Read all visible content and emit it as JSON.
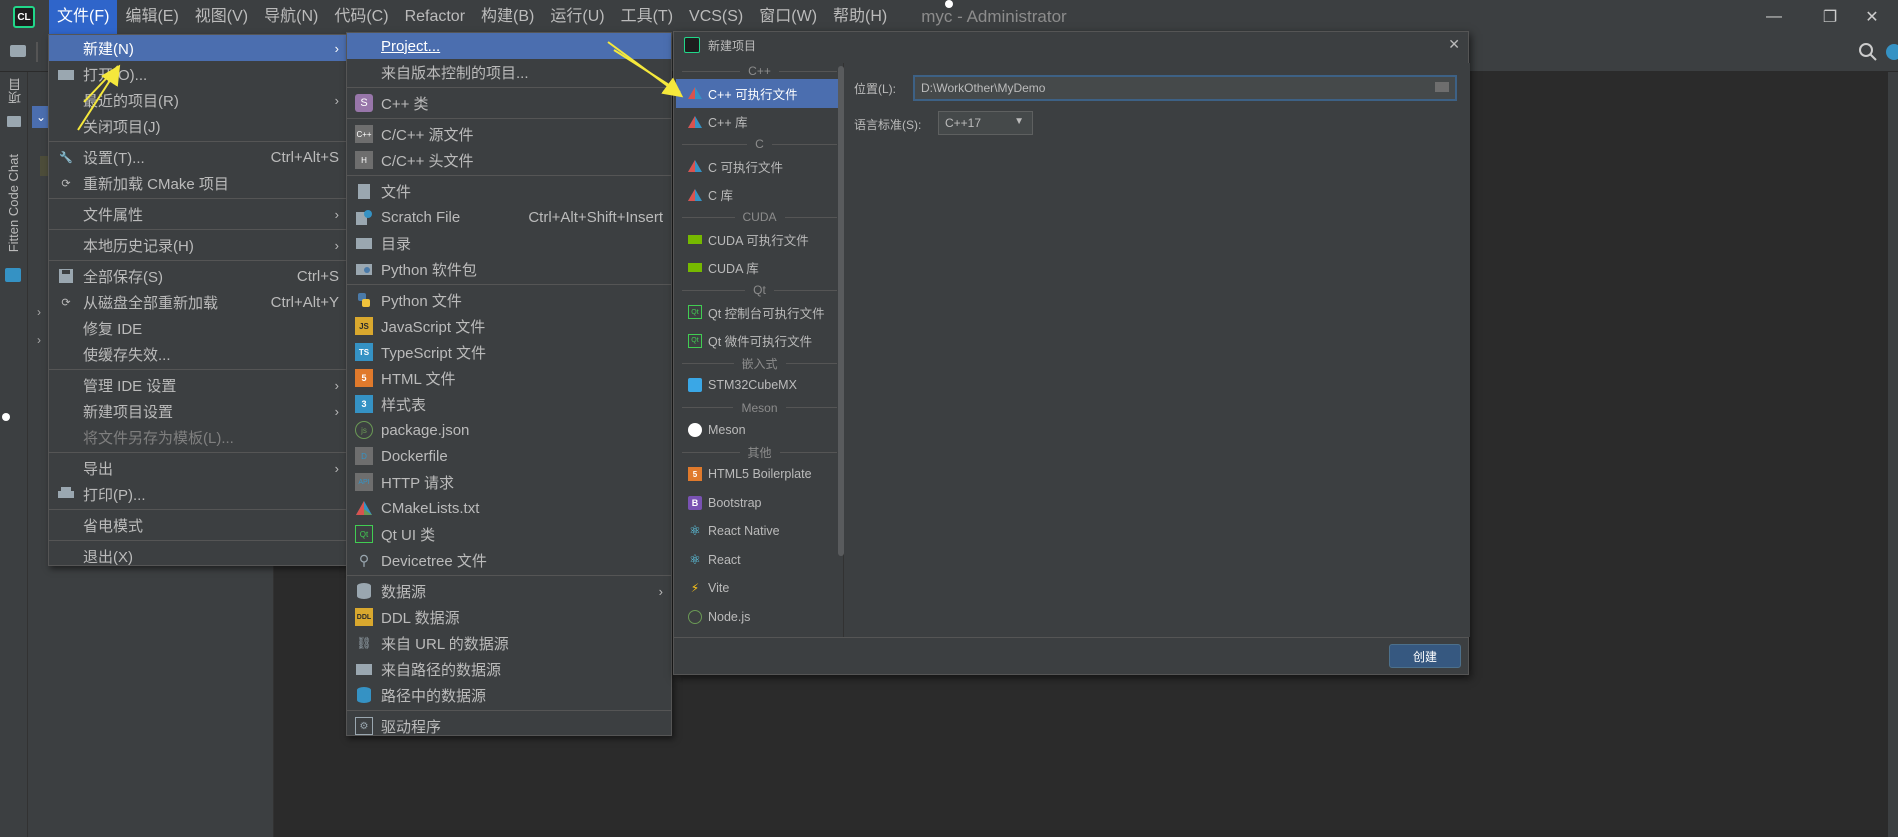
{
  "window": {
    "title": "myc - Administrator",
    "minimize": "—",
    "restore": "❐",
    "close": "✕",
    "app_icon": "CL"
  },
  "menubar": [
    {
      "label": "文件(F)"
    },
    {
      "label": "编辑(E)"
    },
    {
      "label": "视图(V)"
    },
    {
      "label": "导航(N)"
    },
    {
      "label": "代码(C)"
    },
    {
      "label": "Refactor"
    },
    {
      "label": "构建(B)"
    },
    {
      "label": "运行(U)"
    },
    {
      "label": "工具(T)"
    },
    {
      "label": "VCS(S)"
    },
    {
      "label": "窗口(W)"
    },
    {
      "label": "帮助(H)"
    }
  ],
  "left_strip": {
    "project_label": "项目",
    "fitten_label": "Fitten Code Chat"
  },
  "file_menu": {
    "new": "新建(N)",
    "open": "打开(O)...",
    "recent": "最近的项目(R)",
    "close_project": "关闭项目(J)",
    "settings": "设置(T)...",
    "settings_sc": "Ctrl+Alt+S",
    "reload_cmake": "重新加载 CMake 项目",
    "file_props": "文件属性",
    "local_history": "本地历史记录(H)",
    "save_all": "全部保存(S)",
    "save_all_sc": "Ctrl+S",
    "reload_disk": "从磁盘全部重新加载",
    "reload_disk_sc": "Ctrl+Alt+Y",
    "repair_ide": "修复 IDE",
    "invalidate": "使缓存失效...",
    "manage_ide": "管理 IDE 设置",
    "new_project_settings": "新建项目设置",
    "save_template": "将文件另存为模板(L)...",
    "export": "导出",
    "print": "打印(P)...",
    "power_save": "省电模式",
    "exit": "退出(X)"
  },
  "new_menu": {
    "project": "Project...",
    "from_vcs": "来自版本控制的项目...",
    "cpp_class": "C++ 类",
    "cpp_source": "C/C++ 源文件",
    "cpp_header": "C/C++ 头文件",
    "file": "文件",
    "scratch": "Scratch File",
    "scratch_sc": "Ctrl+Alt+Shift+Insert",
    "directory": "目录",
    "python_pkg": "Python 软件包",
    "python_file": "Python 文件",
    "js_file": "JavaScript 文件",
    "ts_file": "TypeScript 文件",
    "html_file": "HTML 文件",
    "stylesheet": "样式表",
    "package_json": "package.json",
    "dockerfile": "Dockerfile",
    "http_request": "HTTP 请求",
    "cmakelists": "CMakeLists.txt",
    "qt_ui": "Qt UI 类",
    "devicetree": "Devicetree 文件",
    "datasource": "数据源",
    "ddl": "DDL 数据源",
    "url_ds": "来自 URL 的数据源",
    "path_ds": "来自路径的数据源",
    "in_path_ds": "路径中的数据源",
    "driver": "驱动程序"
  },
  "dialog": {
    "title": "新建项目",
    "close": "✕",
    "groups": {
      "cpp": "C++",
      "c": "C",
      "cuda": "CUDA",
      "qt": "Qt",
      "embedded": "嵌入式",
      "meson": "Meson",
      "other": "其他"
    },
    "items": {
      "cpp_exe": "C++ 可执行文件",
      "cpp_lib": "C++ 库",
      "c_exe": "C 可执行文件",
      "c_lib": "C 库",
      "cuda_exe": "CUDA 可执行文件",
      "cuda_lib": "CUDA 库",
      "qt_console": "Qt 控制台可执行文件",
      "qt_widget": "Qt 微件可执行文件",
      "stm32": "STM32CubeMX",
      "meson": "Meson",
      "html5": "HTML5 Boilerplate",
      "bootstrap": "Bootstrap",
      "react_native": "React Native",
      "react": "React",
      "vite": "Vite",
      "nodejs": "Node.js"
    },
    "location_label": "位置(L):",
    "location_value": "D:\\WorkOther\\MyDemo",
    "lang_label": "语言标准(S):",
    "lang_value": "C++17",
    "create_button": "创建"
  }
}
